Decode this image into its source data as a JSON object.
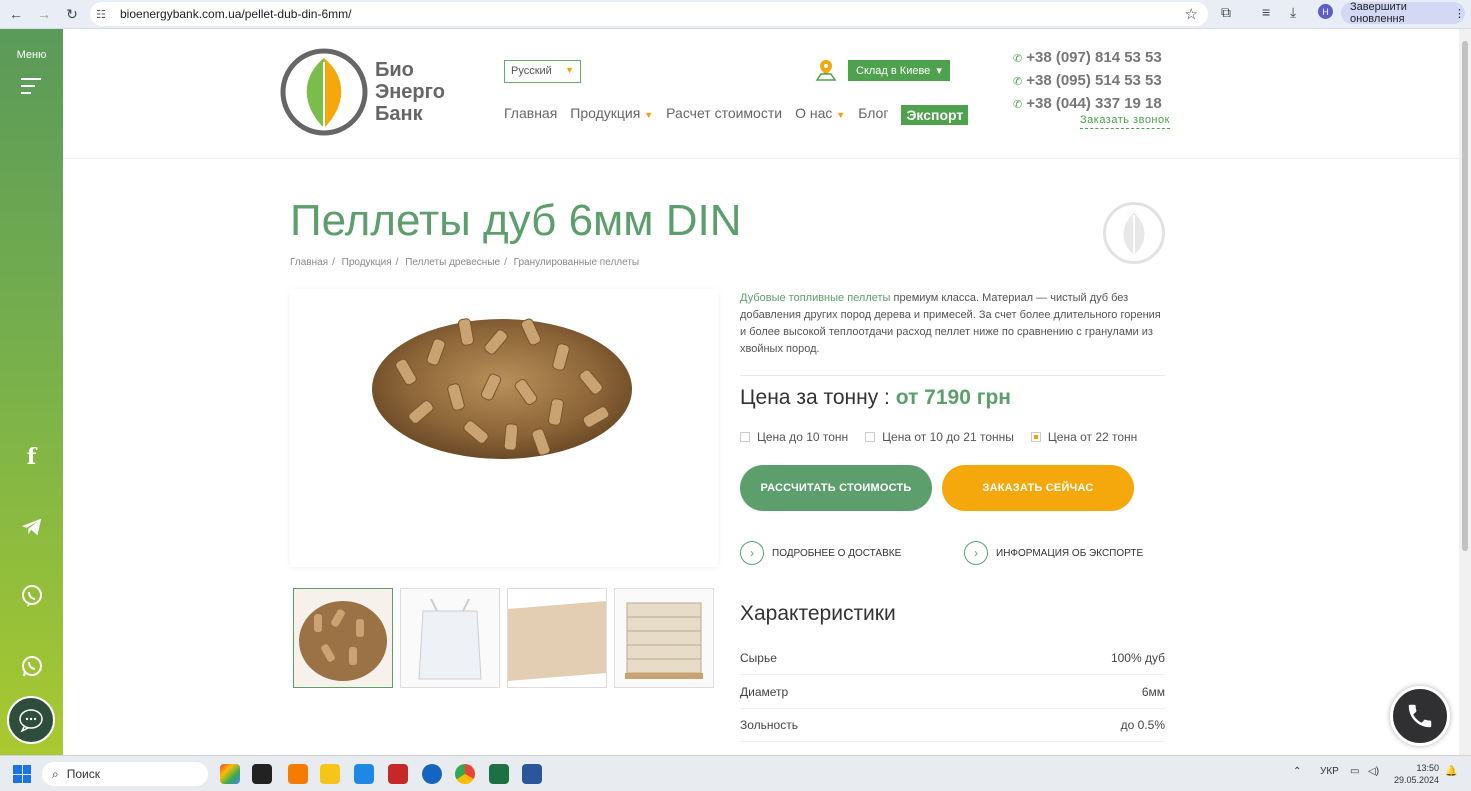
{
  "browser": {
    "url": "bioenergybank.com.ua/pellet-dub-din-6mm/",
    "update_label": "Завершити оновлення",
    "profile_initial": "Н"
  },
  "sidebar": {
    "menu_label": "Меню",
    "socials": [
      "facebook-icon",
      "telegram-icon",
      "viber-icon",
      "whatsapp-icon"
    ]
  },
  "header": {
    "logo_lines": [
      "Био",
      "Энерго",
      "Банк"
    ],
    "language": "Русский",
    "stock_label": "Склад в Киеве",
    "nav": {
      "home": "Главная",
      "products": "Продукция",
      "calc": "Расчет стоимости",
      "about": "О нас",
      "blog": "Блог",
      "export": "Экспорт"
    },
    "phones": [
      "+38 (097) 814 53 53",
      "+38 (095) 514 53 53",
      "+38 (044) 337 19 18"
    ],
    "callback": "Заказать звонок"
  },
  "product": {
    "title": "Пеллеты дуб 6мм DIN",
    "breadcrumbs": [
      "Главная",
      "Продукция",
      "Пеллеты древесные",
      "Гранулированные пеллеты"
    ],
    "desc_link": "Дубовые топливные пеллеты",
    "desc_rest": " премиум класса. Материал — чистый дуб без добавления других пород дерева и примесей. За счет более длительного горения и более высокой теплоотдачи расход пеллет ниже по сравнению с гранулами из хвойных пород.",
    "price_label": "Цена за тонну :",
    "price_value": "от 7190 грн",
    "options": [
      {
        "label": "Цена до 10 тонн",
        "checked": false
      },
      {
        "label": "Цена от 10 до 21 тонны",
        "checked": false
      },
      {
        "label": "Цена от 22 тонн",
        "checked": true
      }
    ],
    "calc_button": "РАССЧИТАТЬ СТОИМОСТЬ",
    "order_button": "ЗАКАЗАТЬ СЕЙЧАС",
    "delivery_link": "ПОДРОБНЕЕ О ДОСТАВКЕ",
    "export_link": "ИНФОРМАЦИЯ ОБ ЭКСПОРТЕ",
    "chars_title": "Характеристики",
    "chars": [
      {
        "name": "Сырье",
        "value": "100% дуб"
      },
      {
        "name": "Диаметр",
        "value": "6мм"
      },
      {
        "name": "Зольность",
        "value": "до 0.5%"
      }
    ]
  },
  "taskbar": {
    "search_label": "Поиск",
    "lang": "УКР",
    "time": "13:50",
    "date": "29.05.2024"
  },
  "colors": {
    "brand_green": "#5c9f6c",
    "accent_orange": "#f5a80c"
  }
}
